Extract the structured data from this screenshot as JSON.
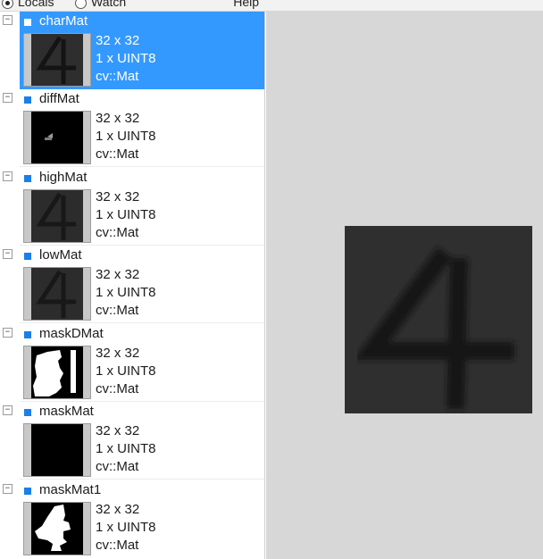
{
  "toolbar": {
    "locals_label": "Locals",
    "watch_label": "Watch",
    "help_label": "Help"
  },
  "variables": [
    {
      "name": "charMat",
      "size": "32 x 32",
      "channels": "1 x UINT8",
      "type": "cv::Mat",
      "selected": true
    },
    {
      "name": "diffMat",
      "size": "32 x 32",
      "channels": "1 x UINT8",
      "type": "cv::Mat"
    },
    {
      "name": "highMat",
      "size": "32 x 32",
      "channels": "1 x UINT8",
      "type": "cv::Mat"
    },
    {
      "name": "lowMat",
      "size": "32 x 32",
      "channels": "1 x UINT8",
      "type": "cv::Mat"
    },
    {
      "name": "maskDMat",
      "size": "32 x 32",
      "channels": "1 x UINT8",
      "type": "cv::Mat"
    },
    {
      "name": "maskMat",
      "size": "32 x 32",
      "channels": "1 x UINT8",
      "type": "cv::Mat"
    },
    {
      "name": "maskMat1",
      "size": "32 x 32",
      "channels": "1 x UINT8",
      "type": "cv::Mat"
    }
  ],
  "expander_symbol": "−",
  "colors": {
    "selection": "#3399ff",
    "bullet": "#1a7fe8",
    "preview_bg": "#d7d7d7"
  }
}
